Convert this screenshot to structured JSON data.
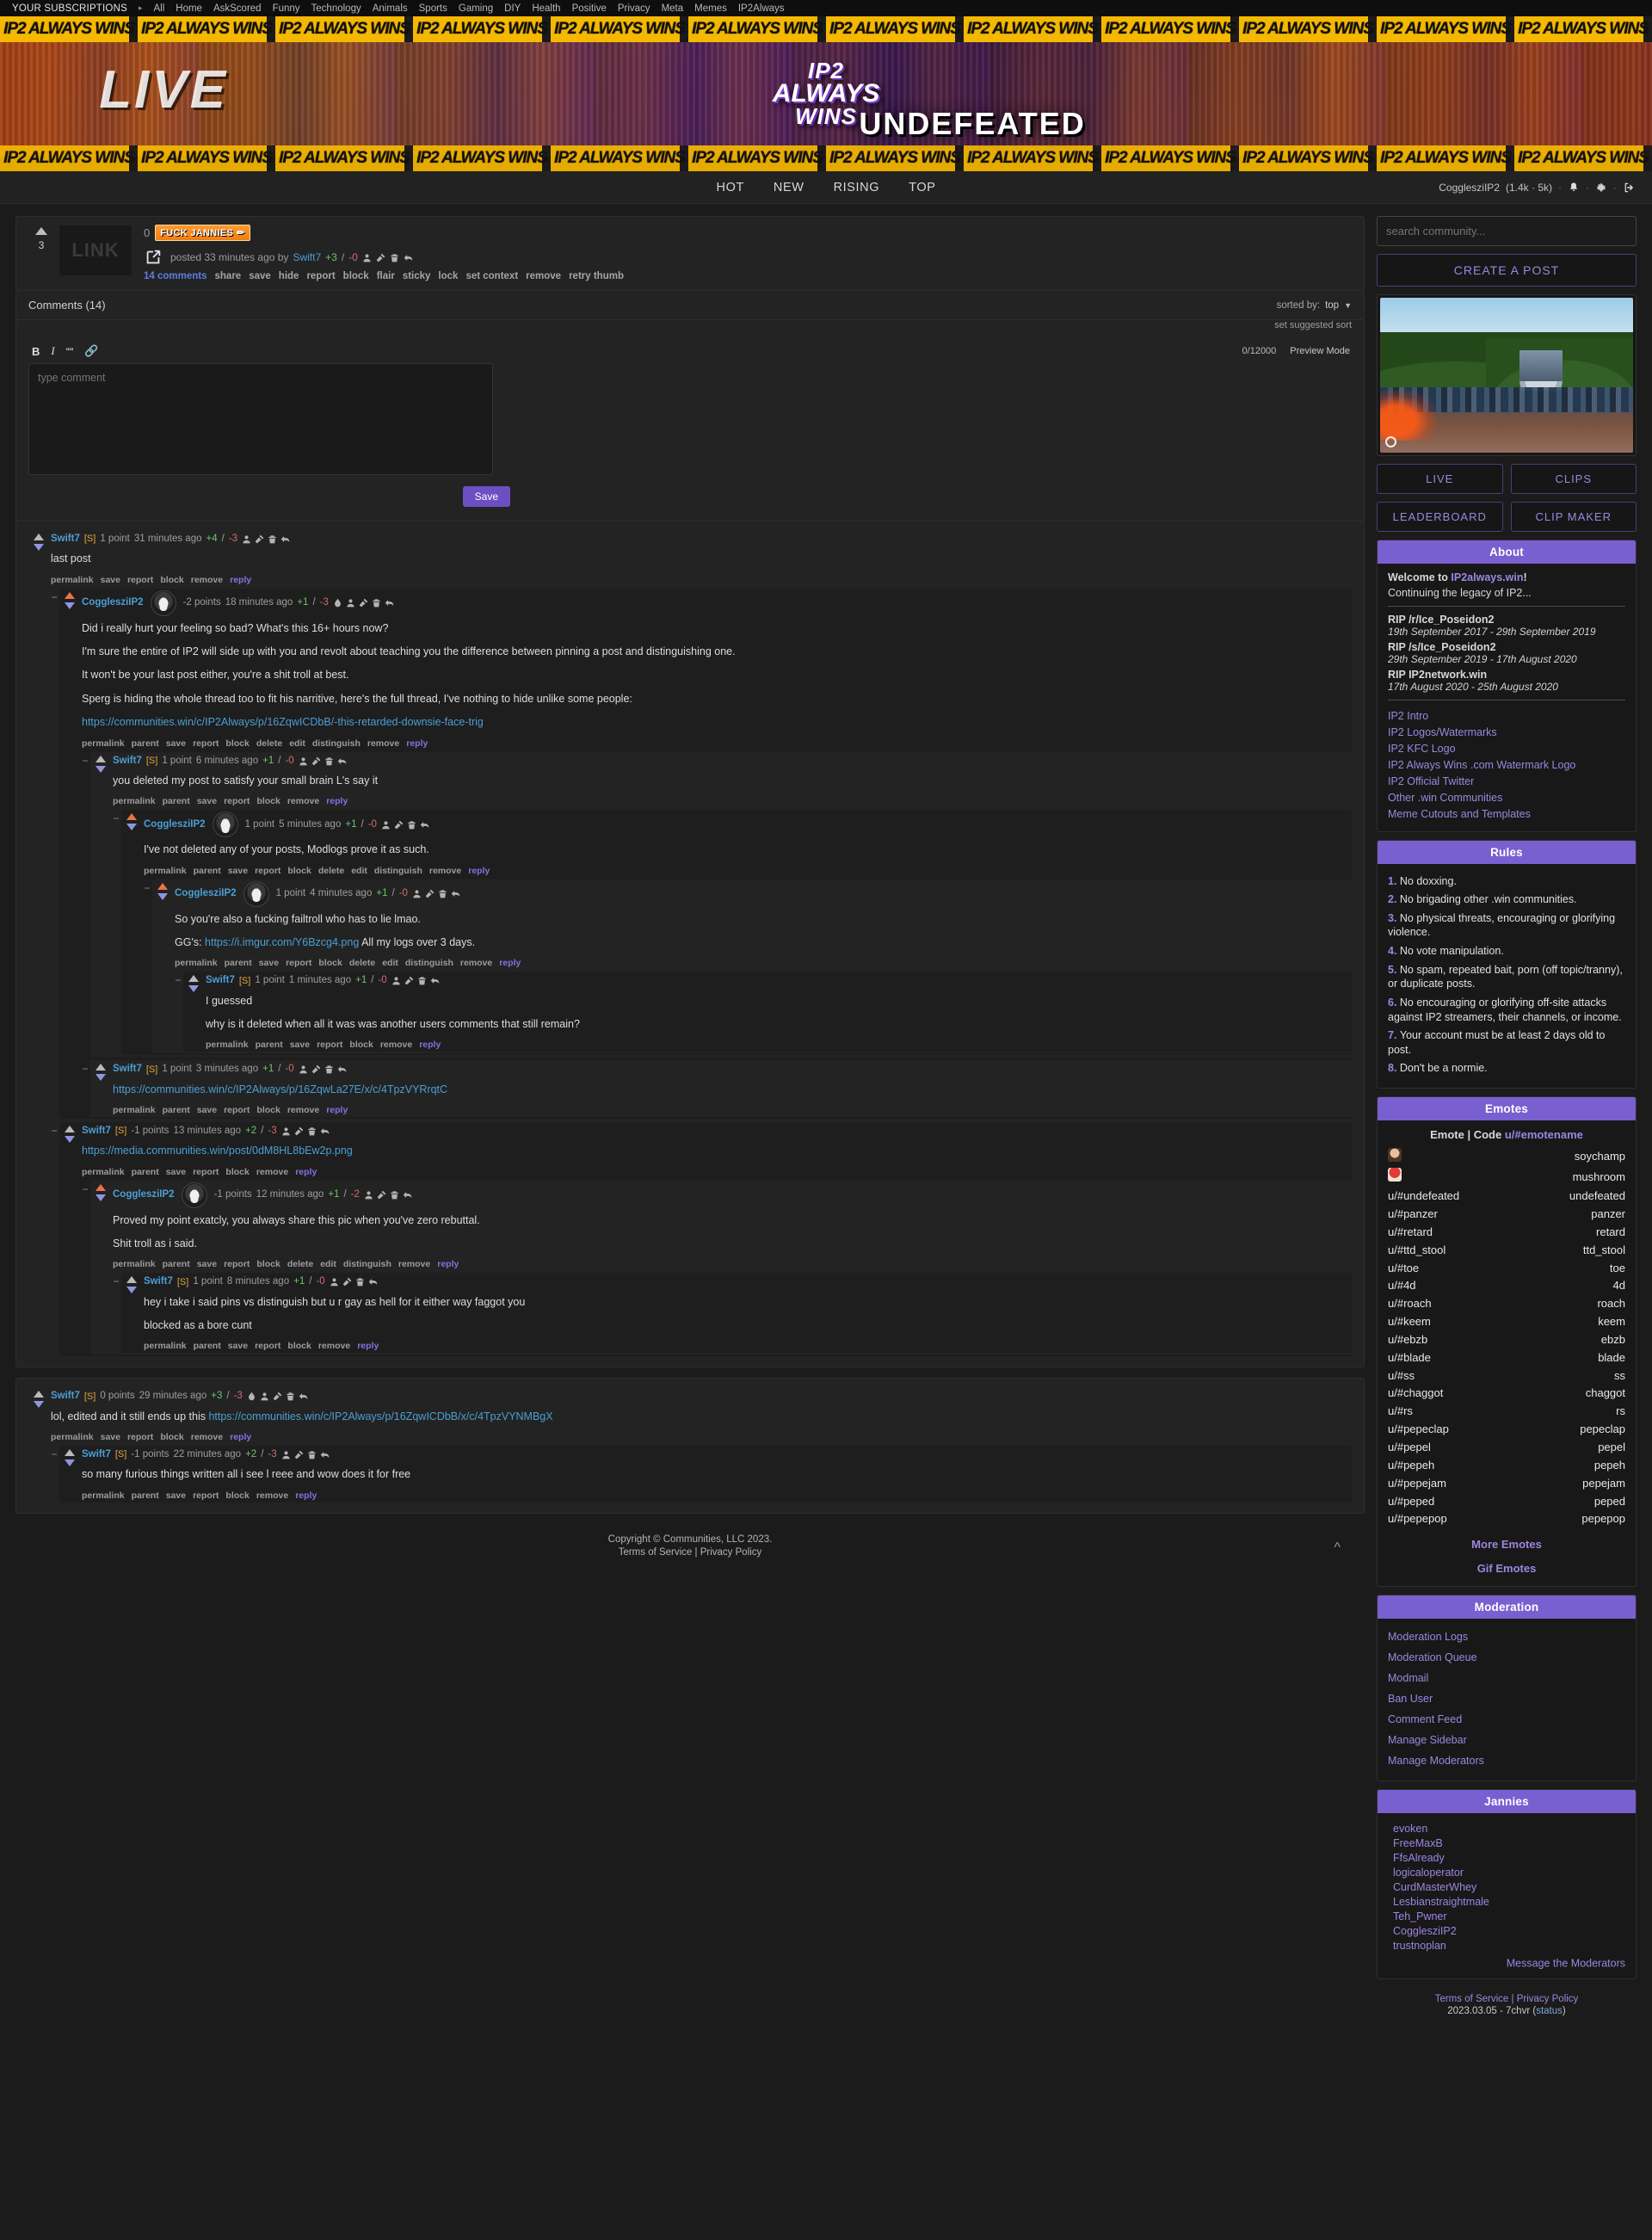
{
  "subscriptions": {
    "title": "YOUR SUBSCRIPTIONS",
    "caret": "▸",
    "items": [
      "All",
      "Home",
      "AskScored",
      "Funny",
      "Technology",
      "Animals",
      "Sports",
      "Gaming",
      "DIY",
      "Health",
      "Positive",
      "Privacy",
      "Meta",
      "Memes",
      "IP2Always"
    ]
  },
  "banner": {
    "strip_text": "IP2 ALWAYS WINS",
    "live_text": "LIVE",
    "ip2_text": "IP2",
    "always_text": "ALWAYS",
    "wins_text": "WINS",
    "undefeated_text": "UNDEFEATED"
  },
  "nav": {
    "tabs": [
      "HOT",
      "NEW",
      "RISING",
      "TOP"
    ],
    "user": "CogglesziIP2",
    "user_stats": "(1.4k · 5k)",
    "sep": "·",
    "bell_icon": "bell-icon",
    "gear_icon": "gear-icon",
    "logout_icon": "logout-icon"
  },
  "post": {
    "score": "3",
    "thumb_label": "LINK",
    "title_prefix": "0",
    "flair": "FUCK JANNIES",
    "flair_icon": "✏",
    "meta_posted": "posted 33 minutes ago by",
    "author": "Swift7",
    "up": "+3",
    "slash": "/",
    "down": "-0",
    "actions": [
      "14 comments",
      "share",
      "save",
      "hide",
      "report",
      "block",
      "flair",
      "sticky",
      "lock",
      "set context",
      "remove",
      "retry thumb"
    ]
  },
  "comments_header": {
    "title": "Comments (14)",
    "sorted_by_label": "sorted by:",
    "sorted_by_value": "top",
    "set_suggested_sort": "set suggested sort"
  },
  "editor": {
    "bold": "B",
    "italic": "I",
    "quote": "““",
    "link_icon": "link-icon",
    "counter": "0/12000",
    "preview_mode": "Preview Mode",
    "placeholder": "type comment",
    "save_label": "Save"
  },
  "actions_basic": [
    "permalink",
    "save",
    "report",
    "block",
    "remove",
    "reply"
  ],
  "actions_parent": [
    "permalink",
    "parent",
    "save",
    "report",
    "block",
    "remove",
    "reply"
  ],
  "actions_mod": [
    "permalink",
    "parent",
    "save",
    "report",
    "block",
    "delete",
    "edit",
    "distinguish",
    "remove",
    "reply"
  ],
  "threads": [
    {
      "id": "t1",
      "author": "Swift7",
      "tag": "[S]",
      "points": "1 point",
      "age": "31 minutes ago",
      "up": "+4",
      "down": "-3",
      "avatar": false,
      "text": [
        "last post"
      ],
      "actions": "basic",
      "children": [
        {
          "id": "c1",
          "author": "CogglesziIP2",
          "tag": "",
          "points": "-2 points",
          "age": "18 minutes ago",
          "up": "+1",
          "down": "-3",
          "avatar": true,
          "text": [
            "Did i really hurt your feeling so bad? What's this 16+ hours now?",
            "I'm sure the entire of IP2 will side up with you and revolt about teaching you the difference between pinning a post and distinguishing one.",
            "It won't be your last post either, you're a shit troll at best.",
            "Sperg is hiding the whole thread too to fit his narritive, here's the full thread, I've nothing to hide unlike some people:"
          ],
          "link": "https://communities.win/c/IP2Always/p/16ZqwICDbB/-this-retarded-downsie-face-trig",
          "actions": "mod",
          "children": [
            {
              "id": "c2",
              "author": "Swift7",
              "tag": "[S]",
              "points": "1 point",
              "age": "6 minutes ago",
              "up": "+1",
              "down": "-0",
              "avatar": false,
              "text": [
                "you deleted my post to satisfy your small brain L's say it"
              ],
              "actions": "parent",
              "children": [
                {
                  "id": "c3",
                  "author": "CogglesziIP2",
                  "tag": "",
                  "points": "1 point",
                  "age": "5 minutes ago",
                  "up": "+1",
                  "down": "-0",
                  "avatar": true,
                  "text": [
                    "I've not deleted any of your posts, Modlogs prove it as such."
                  ],
                  "actions": "mod",
                  "children": [
                    {
                      "id": "c4",
                      "author": "CogglesziIP2",
                      "tag": "",
                      "points": "1 point",
                      "age": "4 minutes ago",
                      "up": "+1",
                      "down": "-0",
                      "avatar": true,
                      "text": [
                        "So you're also a fucking failtroll who has to lie lmao."
                      ],
                      "prefix2": "GG's:",
                      "link": "https://i.imgur.com/Y6Bzcg4.png",
                      "suffix2": "All my logs over 3 days.",
                      "actions": "mod",
                      "children": [
                        {
                          "id": "c5",
                          "author": "Swift7",
                          "tag": "[S]",
                          "points": "1 point",
                          "age": "1 minutes ago",
                          "up": "+1",
                          "down": "-0",
                          "avatar": false,
                          "text": [
                            "I guessed",
                            "why is it deleted when all it was was another users comments that still remain?"
                          ],
                          "actions": "parent",
                          "children": []
                        }
                      ]
                    }
                  ]
                }
              ]
            },
            {
              "id": "c6",
              "author": "Swift7",
              "tag": "[S]",
              "points": "1 point",
              "age": "3 minutes ago",
              "up": "+1",
              "down": "-0",
              "avatar": false,
              "text": [],
              "link": "https://communities.win/c/IP2Always/p/16ZqwLa27E/x/c/4TpzVYRrqtC",
              "actions": "parent",
              "children": []
            }
          ]
        },
        {
          "id": "c7",
          "author": "Swift7",
          "tag": "[S]",
          "points": "-1 points",
          "age": "13 minutes ago",
          "up": "+2",
          "down": "-3",
          "avatar": false,
          "text": [],
          "link": "https://media.communities.win/post/0dM8HL8bEw2p.png",
          "actions": "parent",
          "children": [
            {
              "id": "c8",
              "author": "CogglesziIP2",
              "tag": "",
              "points": "-1 points",
              "age": "12 minutes ago",
              "up": "+1",
              "down": "-2",
              "avatar": true,
              "text": [
                "Proved my point exatcly, you always share this pic when you've zero rebuttal.",
                "Shit troll as i said."
              ],
              "actions": "mod",
              "children": [
                {
                  "id": "c9",
                  "author": "Swift7",
                  "tag": "[S]",
                  "points": "1 point",
                  "age": "8 minutes ago",
                  "up": "+1",
                  "down": "-0",
                  "avatar": false,
                  "text": [
                    "hey i take i said pins vs distinguish but u r gay as hell for it either way faggot you",
                    "blocked as a bore cunt"
                  ],
                  "actions": "parent",
                  "children": []
                }
              ]
            }
          ]
        }
      ]
    },
    {
      "id": "t2",
      "author": "Swift7",
      "tag": "[S]",
      "points": "0 points",
      "age": "29 minutes ago",
      "up": "+3",
      "down": "-3",
      "avatar": false,
      "text": [
        "lol, edited and it still ends up this "
      ],
      "link": "https://communities.win/c/IP2Always/p/16ZqwICDbB/x/c/4TpzVYNMBgX",
      "inline_link": true,
      "actions": "basic",
      "children": [
        {
          "id": "c10",
          "author": "Swift7",
          "tag": "[S]",
          "points": "-1 points",
          "age": "22 minutes ago",
          "up": "+2",
          "down": "-3",
          "avatar": false,
          "text": [
            "so many furious things written all i see l reee and wow does it for free"
          ],
          "actions": "parent",
          "children": []
        }
      ]
    }
  ],
  "sidebar": {
    "search_placeholder": "search community...",
    "create_post": "CREATE A POST",
    "camera_icon": "camera-icon",
    "buttons": [
      "LIVE",
      "CLIPS",
      "LEADERBOARD",
      "CLIP MAKER"
    ],
    "about": {
      "header": "About",
      "welcome_prefix": "Welcome to ",
      "welcome_link": "IP2always.win",
      "welcome_suffix": "!",
      "tagline": "Continuing the legacy of IP2...",
      "rips": [
        {
          "title": "RIP /r/Ice_Poseidon2",
          "dates": "19th September 2017 - 29th September 2019"
        },
        {
          "title": "RIP /s/Ice_Poseidon2",
          "dates": "29th September 2019 - 17th August 2020"
        },
        {
          "title": "RIP IP2network.win",
          "dates": "17th August 2020 - 25th August 2020"
        }
      ],
      "links": [
        "IP2 Intro",
        "IP2 Logos/Watermarks",
        "IP2 KFC Logo",
        "IP2 Always Wins .com Watermark Logo",
        "IP2 Official Twitter",
        "Other .win Communities",
        "Meme Cutouts and Templates"
      ]
    },
    "rules": {
      "header": "Rules",
      "items": [
        "No doxxing.",
        "No brigading other .win communities.",
        "No physical threats, encouraging or glorifying violence.",
        "No vote manipulation.",
        "No spam, repeated bait, porn (off topic/tranny), or duplicate posts.",
        "No encouraging or glorifying off-site attacks against IP2 streamers, their channels, or income.",
        "Your account must be at least 2 days old to post.",
        "Don't be a normie."
      ]
    },
    "emotes": {
      "header": "Emotes",
      "legend_emote": "Emote",
      "legend_sep": "|",
      "legend_code": "Code",
      "legend_sample": "u/#emotename",
      "rows": [
        {
          "code": "",
          "icon": "soychamp-emote-icon",
          "name": "soychamp"
        },
        {
          "code": "",
          "icon": "mushroom-emote-icon",
          "name": "mushroom"
        },
        {
          "code": "u/#undefeated",
          "name": "undefeated"
        },
        {
          "code": "u/#panzer",
          "name": "panzer"
        },
        {
          "code": "u/#retard",
          "name": "retard"
        },
        {
          "code": "u/#ttd_stool",
          "name": "ttd_stool"
        },
        {
          "code": "u/#toe",
          "name": "toe"
        },
        {
          "code": "u/#4d",
          "name": "4d"
        },
        {
          "code": "u/#roach",
          "name": "roach"
        },
        {
          "code": "u/#keem",
          "name": "keem"
        },
        {
          "code": "u/#ebzb",
          "name": "ebzb"
        },
        {
          "code": "u/#blade",
          "name": "blade"
        },
        {
          "code": "u/#ss",
          "name": "ss"
        },
        {
          "code": "u/#chaggot",
          "name": "chaggot"
        },
        {
          "code": "u/#rs",
          "name": "rs"
        },
        {
          "code": "u/#pepeclap",
          "name": "pepeclap"
        },
        {
          "code": "u/#pepel",
          "name": "pepel"
        },
        {
          "code": "u/#pepeh",
          "name": "pepeh"
        },
        {
          "code": "u/#pepejam",
          "name": "pepejam"
        },
        {
          "code": "u/#peped",
          "name": "peped"
        },
        {
          "code": "u/#pepepop",
          "name": "pepepop"
        }
      ],
      "more_emotes": "More Emotes",
      "gif_emotes": "Gif Emotes"
    },
    "moderation": {
      "header": "Moderation",
      "links": [
        "Moderation Logs",
        "Moderation Queue",
        "Modmail",
        "Ban User",
        "Comment Feed",
        "Manage Sidebar",
        "Manage Moderators"
      ]
    },
    "jannies": {
      "header": "Jannies",
      "users": [
        "evoken",
        "FreeMaxB",
        "FfsAlready",
        "logicaloperator",
        "CurdMasterWhey",
        "Lesbianstraightmale",
        "Teh_Pwner",
        "CogglesziIP2",
        "trustnoplan"
      ],
      "message_mods": "Message the Moderators"
    },
    "footer": {
      "tos": "Terms of Service",
      "sep": "|",
      "privacy": "Privacy Policy",
      "version": "2023.03.05 - 7chvr (",
      "status": "status",
      "version_close": ")"
    }
  },
  "footer": {
    "copyright": "Copyright © Communities, LLC 2023.",
    "tos": "Terms of Service",
    "sep": "|",
    "privacy": "Privacy Policy",
    "back_to_top_icon": "chevron-up-icon"
  }
}
